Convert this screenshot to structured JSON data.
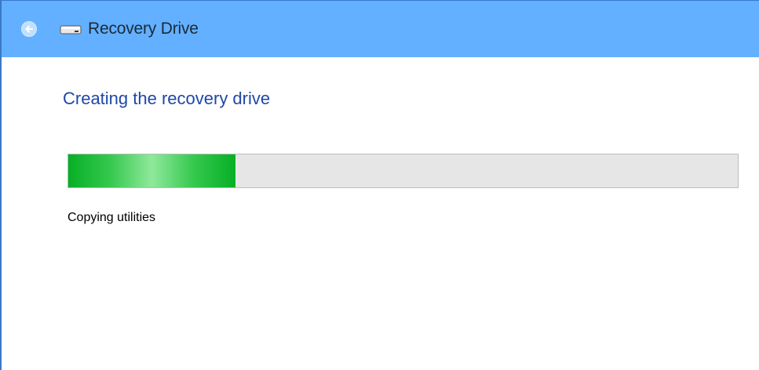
{
  "window": {
    "title": "Recovery Drive",
    "back_icon": "back-arrow-icon",
    "app_icon": "drive-icon"
  },
  "main": {
    "heading": "Creating the recovery drive",
    "progress": {
      "fraction": 0.25
    },
    "status": "Copying utilities"
  },
  "colors": {
    "titlebar": "#62b0ff",
    "heading": "#1f47a8",
    "progress_fill": "#06b025",
    "progress_track": "#e6e6e6"
  }
}
